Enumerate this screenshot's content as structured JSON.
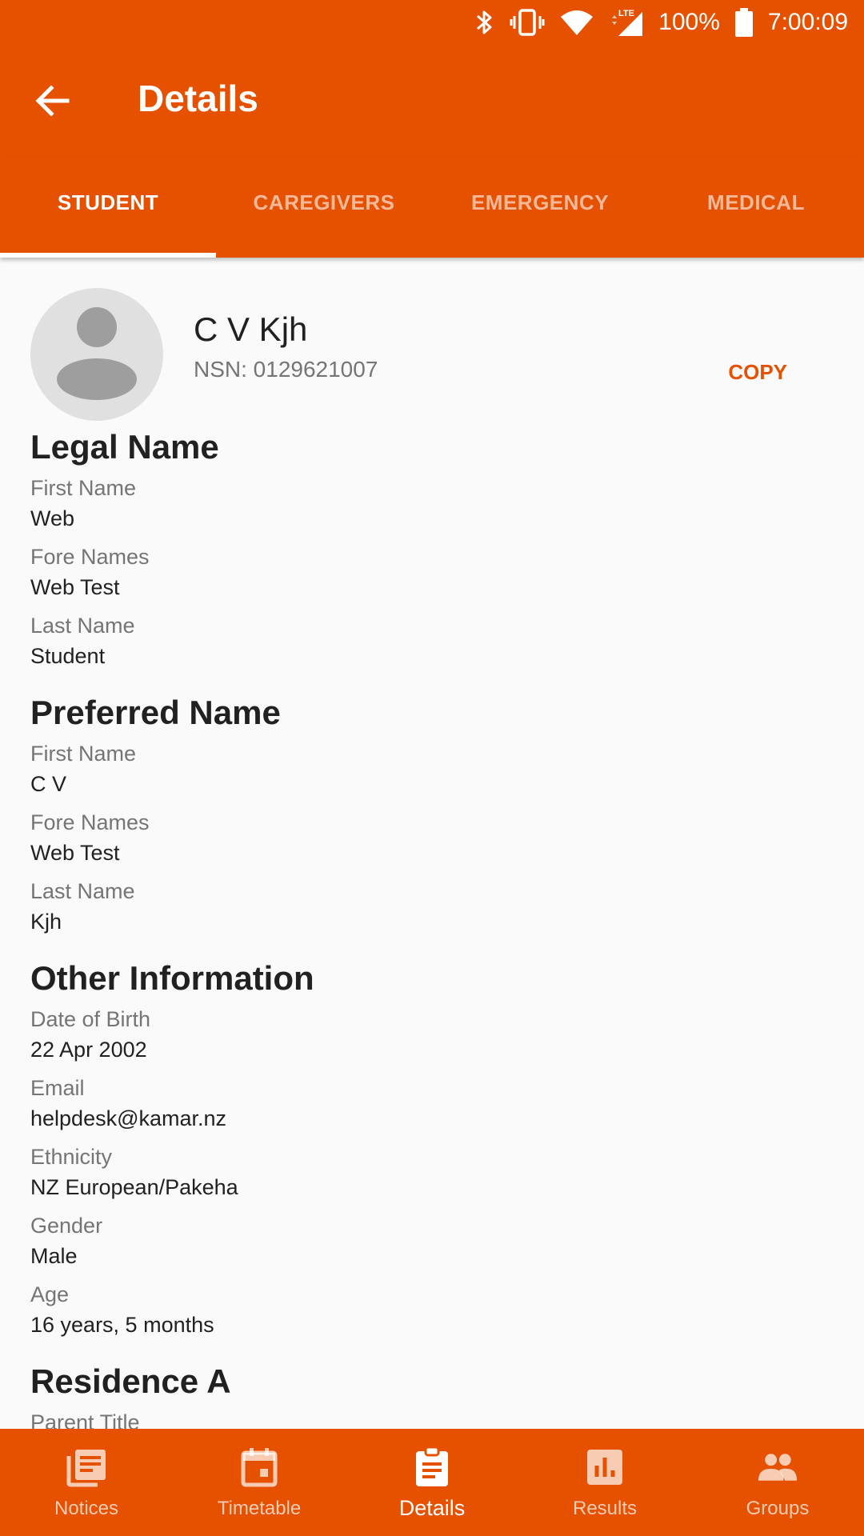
{
  "status_bar": {
    "battery": "100%",
    "time": "7:00:09",
    "network": "LTE",
    "icons": [
      "bluetooth-icon",
      "vibrate-icon",
      "wifi-icon",
      "lte-signal-icon",
      "battery-icon"
    ]
  },
  "app_bar": {
    "title": "Details",
    "back_icon": "arrow-back-icon"
  },
  "tabs": [
    {
      "label": "STUDENT",
      "active": true
    },
    {
      "label": "CAREGIVERS",
      "active": false
    },
    {
      "label": "EMERGENCY",
      "active": false
    },
    {
      "label": "MEDICAL",
      "active": false
    }
  ],
  "profile": {
    "name": "C V Kjh",
    "nsn": "NSN: 0129621007",
    "copy_label": "COPY"
  },
  "sections": {
    "legal_name": {
      "title": "Legal Name",
      "fields": [
        {
          "label": "First Name",
          "value": "Web"
        },
        {
          "label": "Fore Names",
          "value": "Web Test"
        },
        {
          "label": "Last Name",
          "value": "Student"
        }
      ]
    },
    "preferred_name": {
      "title": "Preferred Name",
      "fields": [
        {
          "label": "First Name",
          "value": "C V"
        },
        {
          "label": "Fore Names",
          "value": "Web Test"
        },
        {
          "label": "Last Name",
          "value": "Kjh"
        }
      ]
    },
    "other_information": {
      "title": "Other Information",
      "fields": [
        {
          "label": "Date of Birth",
          "value": "22 Apr 2002"
        },
        {
          "label": "Email",
          "value": "helpdesk@kamar.nz"
        },
        {
          "label": "Ethnicity",
          "value": "NZ European/Pakeha"
        },
        {
          "label": "Gender",
          "value": "Male"
        },
        {
          "label": "Age",
          "value": "16 years, 5 months"
        }
      ]
    },
    "residence_a": {
      "title": "Residence A",
      "fields": [
        {
          "label": "Parent Title",
          "value": ""
        }
      ]
    }
  },
  "bottom_nav": [
    {
      "label": "Notices",
      "icon": "notices-icon",
      "active": false
    },
    {
      "label": "Timetable",
      "icon": "calendar-icon",
      "active": false
    },
    {
      "label": "Details",
      "icon": "clipboard-icon",
      "active": true
    },
    {
      "label": "Results",
      "icon": "bar-chart-icon",
      "active": false
    },
    {
      "label": "Groups",
      "icon": "people-icon",
      "active": false
    }
  ],
  "colors": {
    "primary": "#e65100",
    "background": "#fafafa",
    "text_primary": "#212121",
    "text_secondary": "#757575"
  }
}
